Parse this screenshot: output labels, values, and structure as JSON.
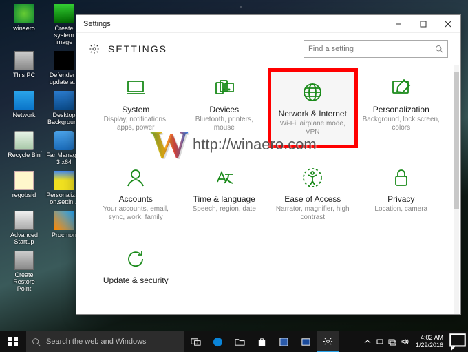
{
  "desktop_icons": [
    {
      "label": "winaero"
    },
    {
      "label": "Create system image"
    },
    {
      "label": "This PC"
    },
    {
      "label": "Defender - update a..."
    },
    {
      "label": "Network"
    },
    {
      "label": "Desktop Background"
    },
    {
      "label": "Recycle Bin"
    },
    {
      "label": "Far Manager 3 x64"
    },
    {
      "label": "regobsid"
    },
    {
      "label": "Personalizati on.settin..."
    },
    {
      "label": "Advanced Startup"
    },
    {
      "label": "Procmon"
    },
    {
      "label": "Create Restore Point"
    }
  ],
  "window": {
    "title": "Settings",
    "heading": "SETTINGS",
    "search_placeholder": "Find a setting"
  },
  "tiles": [
    {
      "name": "System",
      "desc": "Display, notifications, apps, power",
      "icon": "laptop"
    },
    {
      "name": "Devices",
      "desc": "Bluetooth, printers, mouse",
      "icon": "devices"
    },
    {
      "name": "Network & Internet",
      "desc": "Wi-Fi, airplane mode, VPN",
      "icon": "globe",
      "highlight": true
    },
    {
      "name": "Personalization",
      "desc": "Background, lock screen, colors",
      "icon": "pen"
    },
    {
      "name": "Accounts",
      "desc": "Your accounts, email, sync, work, family",
      "icon": "person"
    },
    {
      "name": "Time & language",
      "desc": "Speech, region, date",
      "icon": "lang"
    },
    {
      "name": "Ease of Access",
      "desc": "Narrator, magnifier, high contrast",
      "icon": "ease"
    },
    {
      "name": "Privacy",
      "desc": "Location, camera",
      "icon": "lock"
    },
    {
      "name": "Update & security",
      "desc": "",
      "icon": "update",
      "cutoff": true
    }
  ],
  "watermark": {
    "logo": "W",
    "url": "http://winaero.com"
  },
  "taskbar": {
    "search_placeholder": "Search the web and Windows",
    "clock_time": "4:02 AM",
    "clock_date": "1/29/2016"
  }
}
